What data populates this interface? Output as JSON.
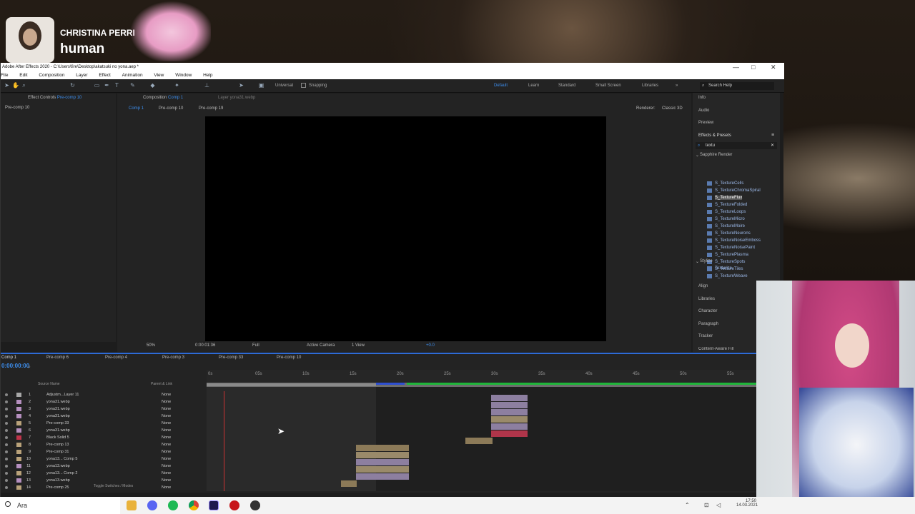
{
  "now_playing": {
    "artist": "CHRISTINA PERRI",
    "title": "human"
  },
  "window": {
    "title": "Adobe After Effects 2020 - C:\\Users\\fire\\Desktop\\akatsuki no yona.aep *",
    "menu": [
      "File",
      "Edit",
      "Composition",
      "Layer",
      "Effect",
      "Animation",
      "View",
      "Window",
      "Help"
    ],
    "controls": [
      "—",
      "□",
      "✕"
    ]
  },
  "toolbar": {
    "universal": "Universal",
    "snapping": "Snapping",
    "workspaces": [
      "Default",
      "Learn",
      "Standard",
      "Small Screen",
      "Libraries"
    ],
    "search_help": "Search Help"
  },
  "left_panel": {
    "tab": "Effect Controls",
    "tab_sub": "Pre-comp 10",
    "breadcrumb": "Pre-comp 10"
  },
  "comp_panel": {
    "tab": "Composition",
    "tab_sub": "Comp 1",
    "layer_tab": "Layer yona31.webp",
    "subtabs": [
      "Comp 1",
      "Pre-comp 10",
      "Pre-comp 19"
    ],
    "renderer": "Renderer:",
    "classic": "Classic 3D",
    "zoom": "50%",
    "time": "0:00:01:36",
    "quality": "Full",
    "camera": "Active Camera",
    "views": "1 View",
    "exposure": "+0.0"
  },
  "right_panel": {
    "top": [
      "Info",
      "Audio",
      "Preview"
    ],
    "effects_title": "Effects & Presets",
    "search": "textu",
    "group": "Sapphire Render",
    "effects": [
      "S_TextureCells",
      "S_TextureChromaSpiral",
      "S_TextureFlux",
      "S_TextureFolded",
      "S_TextureLoops",
      "S_TextureMicro",
      "S_TextureMoire",
      "S_TextureNeurons",
      "S_TextureNoiseEmboss",
      "S_TextureNoisePaint",
      "S_TexturePlasma",
      "S_TextureSpots",
      "S_TextureTiles",
      "S_TextureWeave"
    ],
    "group2": "Stylize",
    "effects2": [
      "Texturize"
    ],
    "bottom": [
      "Align",
      "Libraries",
      "Character",
      "Paragraph",
      "Tracker",
      "Content-Aware Fill"
    ]
  },
  "timeline": {
    "tabs": [
      "Comp 1",
      "Pre-comp 6",
      "Pre-comp 4",
      "Pre-comp 3",
      "Pre-comp 33",
      "Pre-comp 10"
    ],
    "timecode": "0:00:00:00",
    "col_source": "Source Name",
    "col_parent": "Parent & Link",
    "ruler": [
      "0s",
      "05s",
      "10s",
      "15s",
      "20s",
      "25s",
      "30s",
      "35s",
      "40s",
      "45s",
      "50s",
      "55s"
    ],
    "footer": "Toggle Switches / Modes",
    "layers": [
      {
        "num": "1",
        "name": "Adjustm...Layer 11",
        "parent": "None",
        "color": "#a7a7a7"
      },
      {
        "num": "2",
        "name": "yona31.webp",
        "parent": "None",
        "color": "#b58fbf"
      },
      {
        "num": "3",
        "name": "yona31.webp",
        "parent": "None",
        "color": "#b58fbf"
      },
      {
        "num": "4",
        "name": "yona31.webp",
        "parent": "None",
        "color": "#b58fbf"
      },
      {
        "num": "5",
        "name": "Pre-comp 33",
        "parent": "None",
        "color": "#b9a27a"
      },
      {
        "num": "6",
        "name": "yona31.webp",
        "parent": "None",
        "color": "#b58fbf"
      },
      {
        "num": "7",
        "name": "Black Solid 5",
        "parent": "None",
        "color": "#c0334a"
      },
      {
        "num": "8",
        "name": "Pre-comp 13",
        "parent": "None",
        "color": "#b9a27a"
      },
      {
        "num": "9",
        "name": "Pre-comp 31",
        "parent": "None",
        "color": "#b9a27a"
      },
      {
        "num": "10",
        "name": "yona13... Comp 5",
        "parent": "None",
        "color": "#b9a27a"
      },
      {
        "num": "11",
        "name": "yona13.webp",
        "parent": "None",
        "color": "#b58fbf"
      },
      {
        "num": "12",
        "name": "yona13... Comp 2",
        "parent": "None",
        "color": "#b9a27a"
      },
      {
        "num": "13",
        "name": "yona13.webp",
        "parent": "None",
        "color": "#b58fbf"
      },
      {
        "num": "14",
        "name": "Pre-comp 25",
        "parent": "None",
        "color": "#b9a27a"
      }
    ]
  },
  "taskbar": {
    "search": "Ara",
    "time": "17:50",
    "date": "14.03.2021"
  },
  "colors": {
    "accent": "#3d8ff0",
    "timeline_border": "#2e6bd6"
  }
}
